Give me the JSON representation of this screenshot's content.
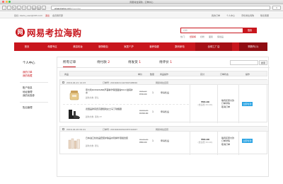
{
  "window": {
    "title": "网易考拉海购 - 订单中心"
  },
  "browser": {
    "url_host": "www.kaola.com",
    "url_path": "/myorder",
    "search_label": "Q"
  },
  "topbar": {
    "greeting": "您好, kaola_user@163.com",
    "logout": "退出",
    "member": "会员俱乐部",
    "links": [
      "我的订单",
      "个人中心",
      "手机考拉海购",
      "联系客服"
    ]
  },
  "header": {
    "logo_char": "网",
    "logo_text": "网易考拉海购",
    "search_placeholder": "奶粉",
    "search_button": "搜索",
    "hot_label": "热门:",
    "hot_words": [
      "纸尿裤",
      "奶粉",
      "面膜",
      "保健品"
    ]
  },
  "nav": {
    "items": [
      "首页",
      "母婴专区",
      "美容彩妆",
      "服饰鞋包",
      "家居个护",
      "营养保健",
      "数码家电",
      "全球工厂店"
    ],
    "cart": "购物车(1)"
  },
  "sidebar": {
    "title": "个人中心",
    "groups": [
      [
        "我的订单",
        "我的收藏"
      ],
      [
        "账户信息",
        "地址管理",
        "我的优惠券"
      ],
      [
        "售后管理"
      ]
    ]
  },
  "tabs": [
    {
      "label": "所有订单",
      "count": ""
    },
    {
      "label": "待付款",
      "count": "2"
    },
    {
      "label": "待发货",
      "count": "1"
    },
    {
      "label": "待评价",
      "count": "1"
    }
  ],
  "order_search": {
    "button": "搜索"
  },
  "table_headers": [
    "商品",
    "单价",
    "数量",
    "商品操作",
    "实付",
    "订单状态",
    "操作"
  ],
  "orders": [
    {
      "time": "2016-04-21 14:23",
      "order_no": "订单号: 20160421142391548840",
      "shop": "网易考拉自营",
      "products": [
        {
          "name": "意大利ROSSMANN芦荟精华保湿面霜50ml滋润补水",
          "spec": "颜色分类: 默认",
          "price": "¥39.00",
          "old_price": "¥68.00",
          "qty": "1",
          "aftersale": "申请售后",
          "icon": "cosmetics-jar-icon"
        },
        {
          "name": "德国品牌真皮高跟短靴女士马丁靴粗跟",
          "spec": "颜色分类: 黑色 37",
          "price": "¥299.00",
          "old_price": "¥399.00",
          "qty": "1",
          "aftersale": "申请售后",
          "icon": "boots-icon"
        }
      ],
      "total": "¥58.00",
      "total_note": "(含运费 ¥0.00)",
      "status": [
        "等待买家付款",
        "订单详情",
        "取消订单"
      ],
      "action": "立即付款"
    },
    {
      "time": "2016-04-20 09:41",
      "order_no": "订单号: 20160420094187210067",
      "shop": "网易考拉自营",
      "products": [
        {
          "name": "日本进口化妆品套装护肤品水乳精华液组合装",
          "spec": "颜色分类: 默认",
          "price": "¥89.00",
          "old_price": "¥129.00",
          "qty": "1",
          "aftersale": "申请售后",
          "icon": "skincare-set-icon"
        }
      ],
      "total": "¥58.00",
      "total_note": "(含运费 ¥0.00)",
      "status": [
        "等待买家付款",
        "订单详情",
        "取消订单"
      ],
      "action": "立即付款"
    }
  ],
  "colors": {
    "brand_red": "#c8161d",
    "pay_blue": "#29a3e3",
    "nav_dark": "#a50f15"
  }
}
